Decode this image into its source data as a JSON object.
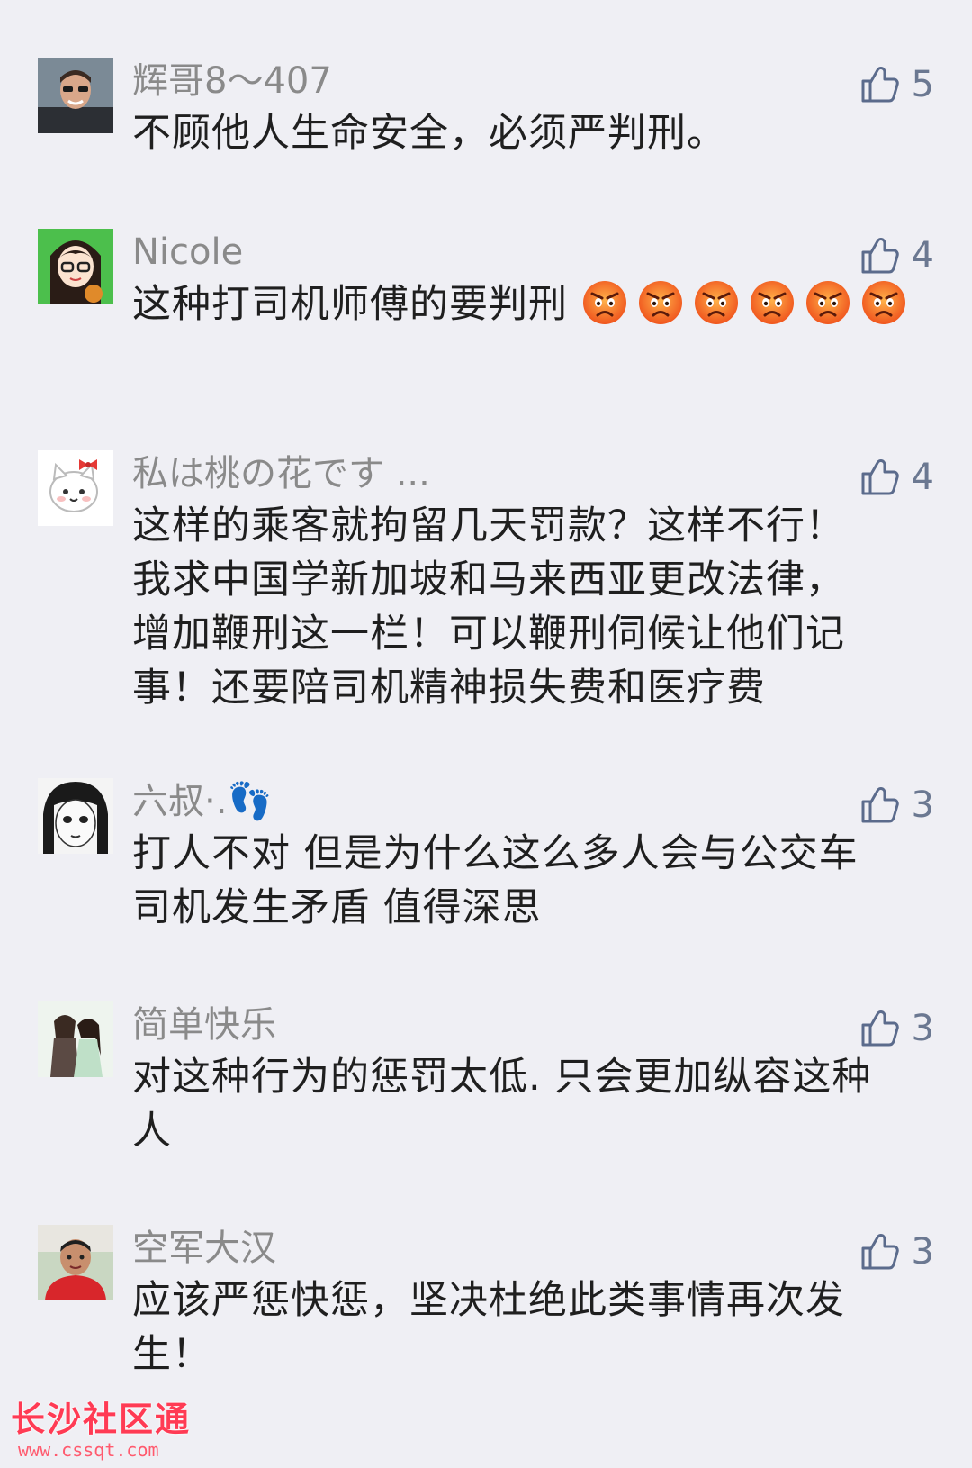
{
  "comments": [
    {
      "nickname": "辉哥8～407",
      "likes": "5",
      "text": "不顾他人生命安全，必须严判刑。"
    },
    {
      "nickname": "Nicole",
      "likes": "4",
      "text": "这种打司机师傅的要判刑",
      "emoji": "angry-face-emoji",
      "emoji_count": 6
    },
    {
      "nickname": "私は桃の花です ...",
      "likes": "4",
      "lines": [
        "这样的乘客就拘留几天罚款？这样不行！",
        "我求中国学新加坡和马来西亚更改法律，",
        "增加鞭刑这一栏！可以鞭刑伺候让他们记",
        "事！还要陪司机精神损失费和医疗费"
      ]
    },
    {
      "nickname": "六叔·.",
      "nickname_icon": "footprints-icon",
      "likes": "3",
      "lines": [
        "打人不对 但是为什么这么多人会与公交车",
        "司机发生矛盾 值得深思"
      ]
    },
    {
      "nickname": "简单快乐",
      "likes": "3",
      "lines": [
        "对这种行为的惩罚太低. 只会更加纵容这种",
        "人"
      ]
    },
    {
      "nickname": "空军大汉",
      "likes": "3",
      "lines": [
        "应该严惩快惩，坚决杜绝此类事情再次发",
        "生！"
      ]
    }
  ],
  "like_icon": "thumbs-up-icon",
  "watermark": {
    "title": "长沙社区通",
    "url": "www.cssqt.com"
  },
  "colors": {
    "background": "#efeff4",
    "nickname": "#8a8a8a",
    "text": "#1f1f1f",
    "like": "#5b6b8c",
    "watermark": "#ff3b54"
  }
}
